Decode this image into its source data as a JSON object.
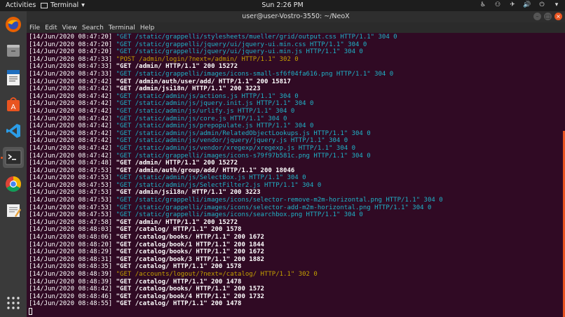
{
  "topbar": {
    "activities": "Activities",
    "app_name": "Terminal",
    "clock": "Sun  2:26 PM"
  },
  "window": {
    "title": "user@user-Vostro-3550: ~/NeoX"
  },
  "menu": [
    "File",
    "Edit",
    "View",
    "Search",
    "Terminal",
    "Help"
  ],
  "dock": [
    {
      "name": "firefox-icon",
      "color": "#e66000"
    },
    {
      "name": "files-icon",
      "color": "#8c8c8c"
    },
    {
      "name": "writer-icon",
      "color": "#1e6fbf"
    },
    {
      "name": "software-center-icon",
      "color": "#e95420"
    },
    {
      "name": "vscode-icon",
      "color": "#2b9de8"
    },
    {
      "name": "terminal-icon",
      "color": "#2c2c2c"
    },
    {
      "name": "chrome-icon",
      "color": "#4caf50"
    },
    {
      "name": "text-editor-icon",
      "color": "#f1f1f1"
    }
  ],
  "log": [
    {
      "ts": "[14/Jun/2020 08:47:20]",
      "req": " \"GET /static/grappelli/stylesheets/mueller/grid/output.css HTTP/1.1\" 304 0",
      "status": "304"
    },
    {
      "ts": "[14/Jun/2020 08:47:20]",
      "req": " \"GET /static/grappelli/jquery/ui/jquery-ui.min.css HTTP/1.1\" 304 0",
      "status": "304"
    },
    {
      "ts": "[14/Jun/2020 08:47:20]",
      "req": " \"GET /static/grappelli/jquery/ui/jquery-ui.min.js HTTP/1.1\" 304 0",
      "status": "304"
    },
    {
      "ts": "[14/Jun/2020 08:47:33]",
      "req": " \"POST /admin/login/?next=/admin/ HTTP/1.1\" 302 0",
      "status": "302"
    },
    {
      "ts": "[14/Jun/2020 08:47:33]",
      "req": " \"GET /admin/ HTTP/1.1\" 200 15272",
      "status": "200"
    },
    {
      "ts": "[14/Jun/2020 08:47:33]",
      "req": " \"GET /static/grappelli/images/icons-small-sf6f04fa616.png HTTP/1.1\" 304 0",
      "status": "304"
    },
    {
      "ts": "[14/Jun/2020 08:47:42]",
      "req": " \"GET /admin/auth/user/add/ HTTP/1.1\" 200 15817",
      "status": "200"
    },
    {
      "ts": "[14/Jun/2020 08:47:42]",
      "req": " \"GET /admin/jsi18n/ HTTP/1.1\" 200 3223",
      "status": "200"
    },
    {
      "ts": "[14/Jun/2020 08:47:42]",
      "req": " \"GET /static/admin/js/actions.js HTTP/1.1\" 304 0",
      "status": "304"
    },
    {
      "ts": "[14/Jun/2020 08:47:42]",
      "req": " \"GET /static/admin/js/jquery.init.js HTTP/1.1\" 304 0",
      "status": "304"
    },
    {
      "ts": "[14/Jun/2020 08:47:42]",
      "req": " \"GET /static/admin/js/urlify.js HTTP/1.1\" 304 0",
      "status": "304"
    },
    {
      "ts": "[14/Jun/2020 08:47:42]",
      "req": " \"GET /static/admin/js/core.js HTTP/1.1\" 304 0",
      "status": "304"
    },
    {
      "ts": "[14/Jun/2020 08:47:42]",
      "req": " \"GET /static/admin/js/prepopulate.js HTTP/1.1\" 304 0",
      "status": "304"
    },
    {
      "ts": "[14/Jun/2020 08:47:42]",
      "req": " \"GET /static/admin/js/admin/RelatedObjectLookups.js HTTP/1.1\" 304 0",
      "status": "304"
    },
    {
      "ts": "[14/Jun/2020 08:47:42]",
      "req": " \"GET /static/admin/js/vendor/jquery/jquery.js HTTP/1.1\" 304 0",
      "status": "304"
    },
    {
      "ts": "[14/Jun/2020 08:47:42]",
      "req": " \"GET /static/admin/js/vendor/xregexp/xregexp.js HTTP/1.1\" 304 0",
      "status": "304"
    },
    {
      "ts": "[14/Jun/2020 08:47:42]",
      "req": " \"GET /static/grappelli/images/icons-s79f97b581c.png HTTP/1.1\" 304 0",
      "status": "304"
    },
    {
      "ts": "[14/Jun/2020 08:47:48]",
      "req": " \"GET /admin/ HTTP/1.1\" 200 15272",
      "status": "200"
    },
    {
      "ts": "[14/Jun/2020 08:47:53]",
      "req": " \"GET /admin/auth/group/add/ HTTP/1.1\" 200 18046",
      "status": "200"
    },
    {
      "ts": "[14/Jun/2020 08:47:53]",
      "req": " \"GET /static/admin/js/SelectBox.js HTTP/1.1\" 304 0",
      "status": "304"
    },
    {
      "ts": "[14/Jun/2020 08:47:53]",
      "req": " \"GET /static/admin/js/SelectFilter2.js HTTP/1.1\" 304 0",
      "status": "304"
    },
    {
      "ts": "[14/Jun/2020 08:47:53]",
      "req": " \"GET /admin/jsi18n/ HTTP/1.1\" 200 3223",
      "status": "200"
    },
    {
      "ts": "[14/Jun/2020 08:47:53]",
      "req": " \"GET /static/grappelli/images/icons/selector-remove-m2m-horizontal.png HTTP/1.1\" 304 0",
      "status": "304"
    },
    {
      "ts": "[14/Jun/2020 08:47:53]",
      "req": " \"GET /static/grappelli/images/icons/selector-add-m2m-horizontal.png HTTP/1.1\" 304 0",
      "status": "304"
    },
    {
      "ts": "[14/Jun/2020 08:47:53]",
      "req": " \"GET /static/grappelli/images/icons/searchbox.png HTTP/1.1\" 304 0",
      "status": "304"
    },
    {
      "ts": "[14/Jun/2020 08:47:58]",
      "req": " \"GET /admin/ HTTP/1.1\" 200 15272",
      "status": "200"
    },
    {
      "ts": "[14/Jun/2020 08:48:03]",
      "req": " \"GET /catalog/ HTTP/1.1\" 200 1578",
      "status": "200"
    },
    {
      "ts": "[14/Jun/2020 08:48:06]",
      "req": " \"GET /catalog/books/ HTTP/1.1\" 200 1672",
      "status": "200"
    },
    {
      "ts": "[14/Jun/2020 08:48:20]",
      "req": " \"GET /catalog/book/1 HTTP/1.1\" 200 1844",
      "status": "200"
    },
    {
      "ts": "[14/Jun/2020 08:48:29]",
      "req": " \"GET /catalog/books/ HTTP/1.1\" 200 1672",
      "status": "200"
    },
    {
      "ts": "[14/Jun/2020 08:48:31]",
      "req": " \"GET /catalog/book/3 HTTP/1.1\" 200 1882",
      "status": "200"
    },
    {
      "ts": "[14/Jun/2020 08:48:35]",
      "req": " \"GET /catalog/ HTTP/1.1\" 200 1578",
      "status": "200"
    },
    {
      "ts": "[14/Jun/2020 08:48:39]",
      "req": " \"GET /accounts/logout/?next=/catalog/ HTTP/1.1\" 302 0",
      "status": "302"
    },
    {
      "ts": "[14/Jun/2020 08:48:39]",
      "req": " \"GET /catalog/ HTTP/1.1\" 200 1478",
      "status": "200"
    },
    {
      "ts": "[14/Jun/2020 08:48:42]",
      "req": " \"GET /catalog/books/ HTTP/1.1\" 200 1572",
      "status": "200"
    },
    {
      "ts": "[14/Jun/2020 08:48:46]",
      "req": " \"GET /catalog/book/4 HTTP/1.1\" 200 1732",
      "status": "200"
    },
    {
      "ts": "[14/Jun/2020 08:48:55]",
      "req": " \"GET /catalog/ HTTP/1.1\" 200 1478",
      "status": "200"
    }
  ]
}
